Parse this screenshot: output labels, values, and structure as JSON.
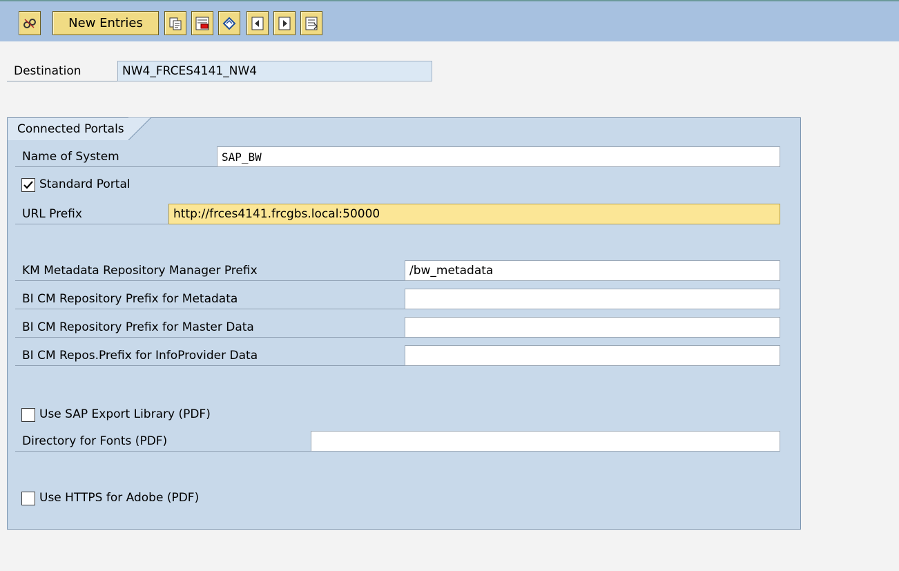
{
  "toolbar": {
    "edit_icon": "glasses-icon",
    "new_entries_label": "New Entries",
    "copy_icon": "copy-icon",
    "delete_icon": "delete-icon",
    "undo_icon": "undo-icon",
    "prev_icon": "previous-entry-icon",
    "next_icon": "next-entry-icon",
    "select_icon": "select-all-icon"
  },
  "destination": {
    "label": "Destination",
    "value": "NW4_FRCES4141_NW4"
  },
  "group": {
    "title": "Connected Portals",
    "name_of_system": {
      "label": "Name of System",
      "value": "SAP_BW"
    },
    "standard_portal": {
      "label": "Standard Portal",
      "checked": true
    },
    "url_prefix": {
      "label": "URL Prefix",
      "value": "http://frces4141.frcgbs.local:50000"
    },
    "km_metadata": {
      "label": "KM Metadata Repository Manager Prefix",
      "value": "/bw_metadata"
    },
    "bi_cm_metadata": {
      "label": "BI CM Repository Prefix for Metadata",
      "value": ""
    },
    "bi_cm_master": {
      "label": "BI CM Repository Prefix for Master Data",
      "value": ""
    },
    "bi_cm_infoprovider": {
      "label": "BI CM Repos.Prefix for InfoProvider Data",
      "value": ""
    },
    "sap_export_library": {
      "label": "Use SAP Export Library (PDF)",
      "checked": false
    },
    "directory_fonts": {
      "label": "Directory for Fonts (PDF)",
      "value": ""
    },
    "https_adobe": {
      "label": "Use HTTPS for Adobe (PDF)",
      "checked": false
    }
  },
  "colors": {
    "toolbar_bg": "#a7c1e0",
    "button_bg": "#f0db84",
    "group_bg": "#c8d9ea",
    "required_field_bg": "#fbe696"
  }
}
